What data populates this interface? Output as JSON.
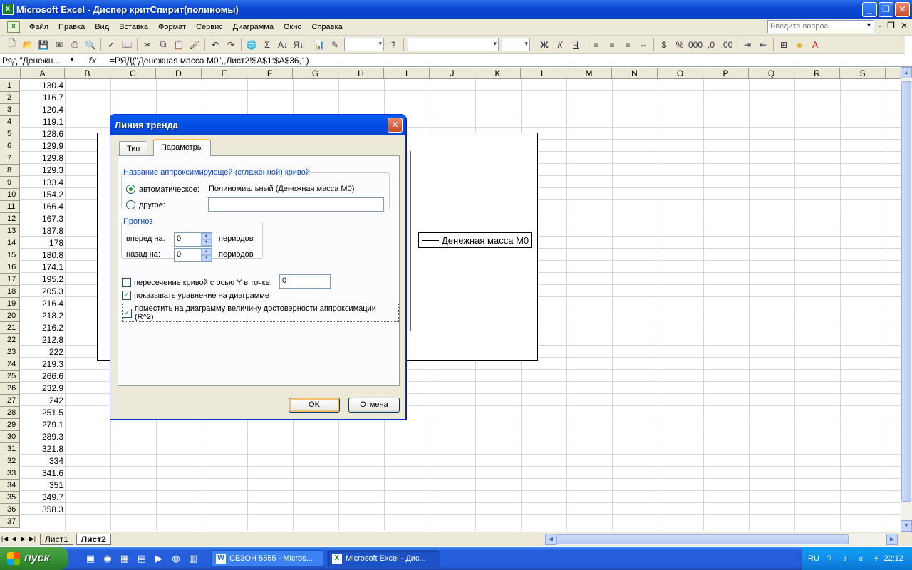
{
  "window": {
    "title": "Microsoft Excel - Диспер критСпирит(полиномы)"
  },
  "menu": {
    "items": [
      "Файл",
      "Правка",
      "Вид",
      "Вставка",
      "Формат",
      "Сервис",
      "Диаграмма",
      "Окно",
      "Справка"
    ],
    "ask_placeholder": "Введите вопрос"
  },
  "formula_bar": {
    "name_box": "Ряд \"Денежн...",
    "formula": "=РЯД(\"Денежная масса М0\",,Лист2!$A$1:$A$36,1)"
  },
  "columns": [
    "A",
    "B",
    "C",
    "D",
    "E",
    "F",
    "G",
    "H",
    "I",
    "J",
    "K",
    "L",
    "M",
    "N",
    "O",
    "P",
    "Q",
    "R",
    "S"
  ],
  "rows": [
    {
      "n": "1",
      "a": "130.4"
    },
    {
      "n": "2",
      "a": "116.7"
    },
    {
      "n": "3",
      "a": "120.4"
    },
    {
      "n": "4",
      "a": "119.1"
    },
    {
      "n": "5",
      "a": "128.6"
    },
    {
      "n": "6",
      "a": "129.9"
    },
    {
      "n": "7",
      "a": "129.8"
    },
    {
      "n": "8",
      "a": "129.3"
    },
    {
      "n": "9",
      "a": "133.4"
    },
    {
      "n": "10",
      "a": "154.2"
    },
    {
      "n": "11",
      "a": "166.4"
    },
    {
      "n": "12",
      "a": "167.3"
    },
    {
      "n": "13",
      "a": "187.8"
    },
    {
      "n": "14",
      "a": "178"
    },
    {
      "n": "15",
      "a": "180.8"
    },
    {
      "n": "16",
      "a": "174.1"
    },
    {
      "n": "17",
      "a": "195.2"
    },
    {
      "n": "18",
      "a": "205.3"
    },
    {
      "n": "19",
      "a": "216.4"
    },
    {
      "n": "20",
      "a": "218.2"
    },
    {
      "n": "21",
      "a": "216.2"
    },
    {
      "n": "22",
      "a": "212.8"
    },
    {
      "n": "23",
      "a": "222"
    },
    {
      "n": "24",
      "a": "219.3"
    },
    {
      "n": "25",
      "a": "266.6"
    },
    {
      "n": "26",
      "a": "232.9"
    },
    {
      "n": "27",
      "a": "242"
    },
    {
      "n": "28",
      "a": "251.5"
    },
    {
      "n": "29",
      "a": "279.1"
    },
    {
      "n": "30",
      "a": "289.3"
    },
    {
      "n": "31",
      "a": "321.8"
    },
    {
      "n": "32",
      "a": "334"
    },
    {
      "n": "33",
      "a": "341.6"
    },
    {
      "n": "34",
      "a": "351"
    },
    {
      "n": "35",
      "a": "349.7"
    },
    {
      "n": "36",
      "a": "358.3"
    },
    {
      "n": "37",
      "a": ""
    }
  ],
  "chart": {
    "legend": "Денежная масса М0"
  },
  "sheets": [
    "Лист1",
    "Лист2"
  ],
  "dialog": {
    "title": "Линия тренда",
    "tabs": [
      "Тип",
      "Параметры"
    ],
    "name_group": "Название аппроксимирующей (сглаженной) кривой",
    "auto_label": "автоматическое:",
    "auto_value": "Полиномиальный (Денежная масса М0)",
    "other_label": "другое:",
    "other_value": "",
    "forecast_group": "Прогноз",
    "forward_label": "вперед на:",
    "forward_value": "0",
    "backward_label": "назад на:",
    "backward_value": "0",
    "periods": "периодов",
    "intercept_label": "пересечение кривой с осью Y в точке:",
    "intercept_value": "0",
    "show_equation": "показывать уравнение на диаграмме",
    "show_r2": "поместить на диаграмму величину достоверности аппроксимации (R^2)",
    "ok": "OK",
    "cancel": "Отмена"
  },
  "taskbar": {
    "start": "пуск",
    "tasks": [
      "СЕЗОН 5555 - Micros...",
      "Microsoft Excel - Дис..."
    ],
    "lang": "RU",
    "clock": "22:12"
  }
}
